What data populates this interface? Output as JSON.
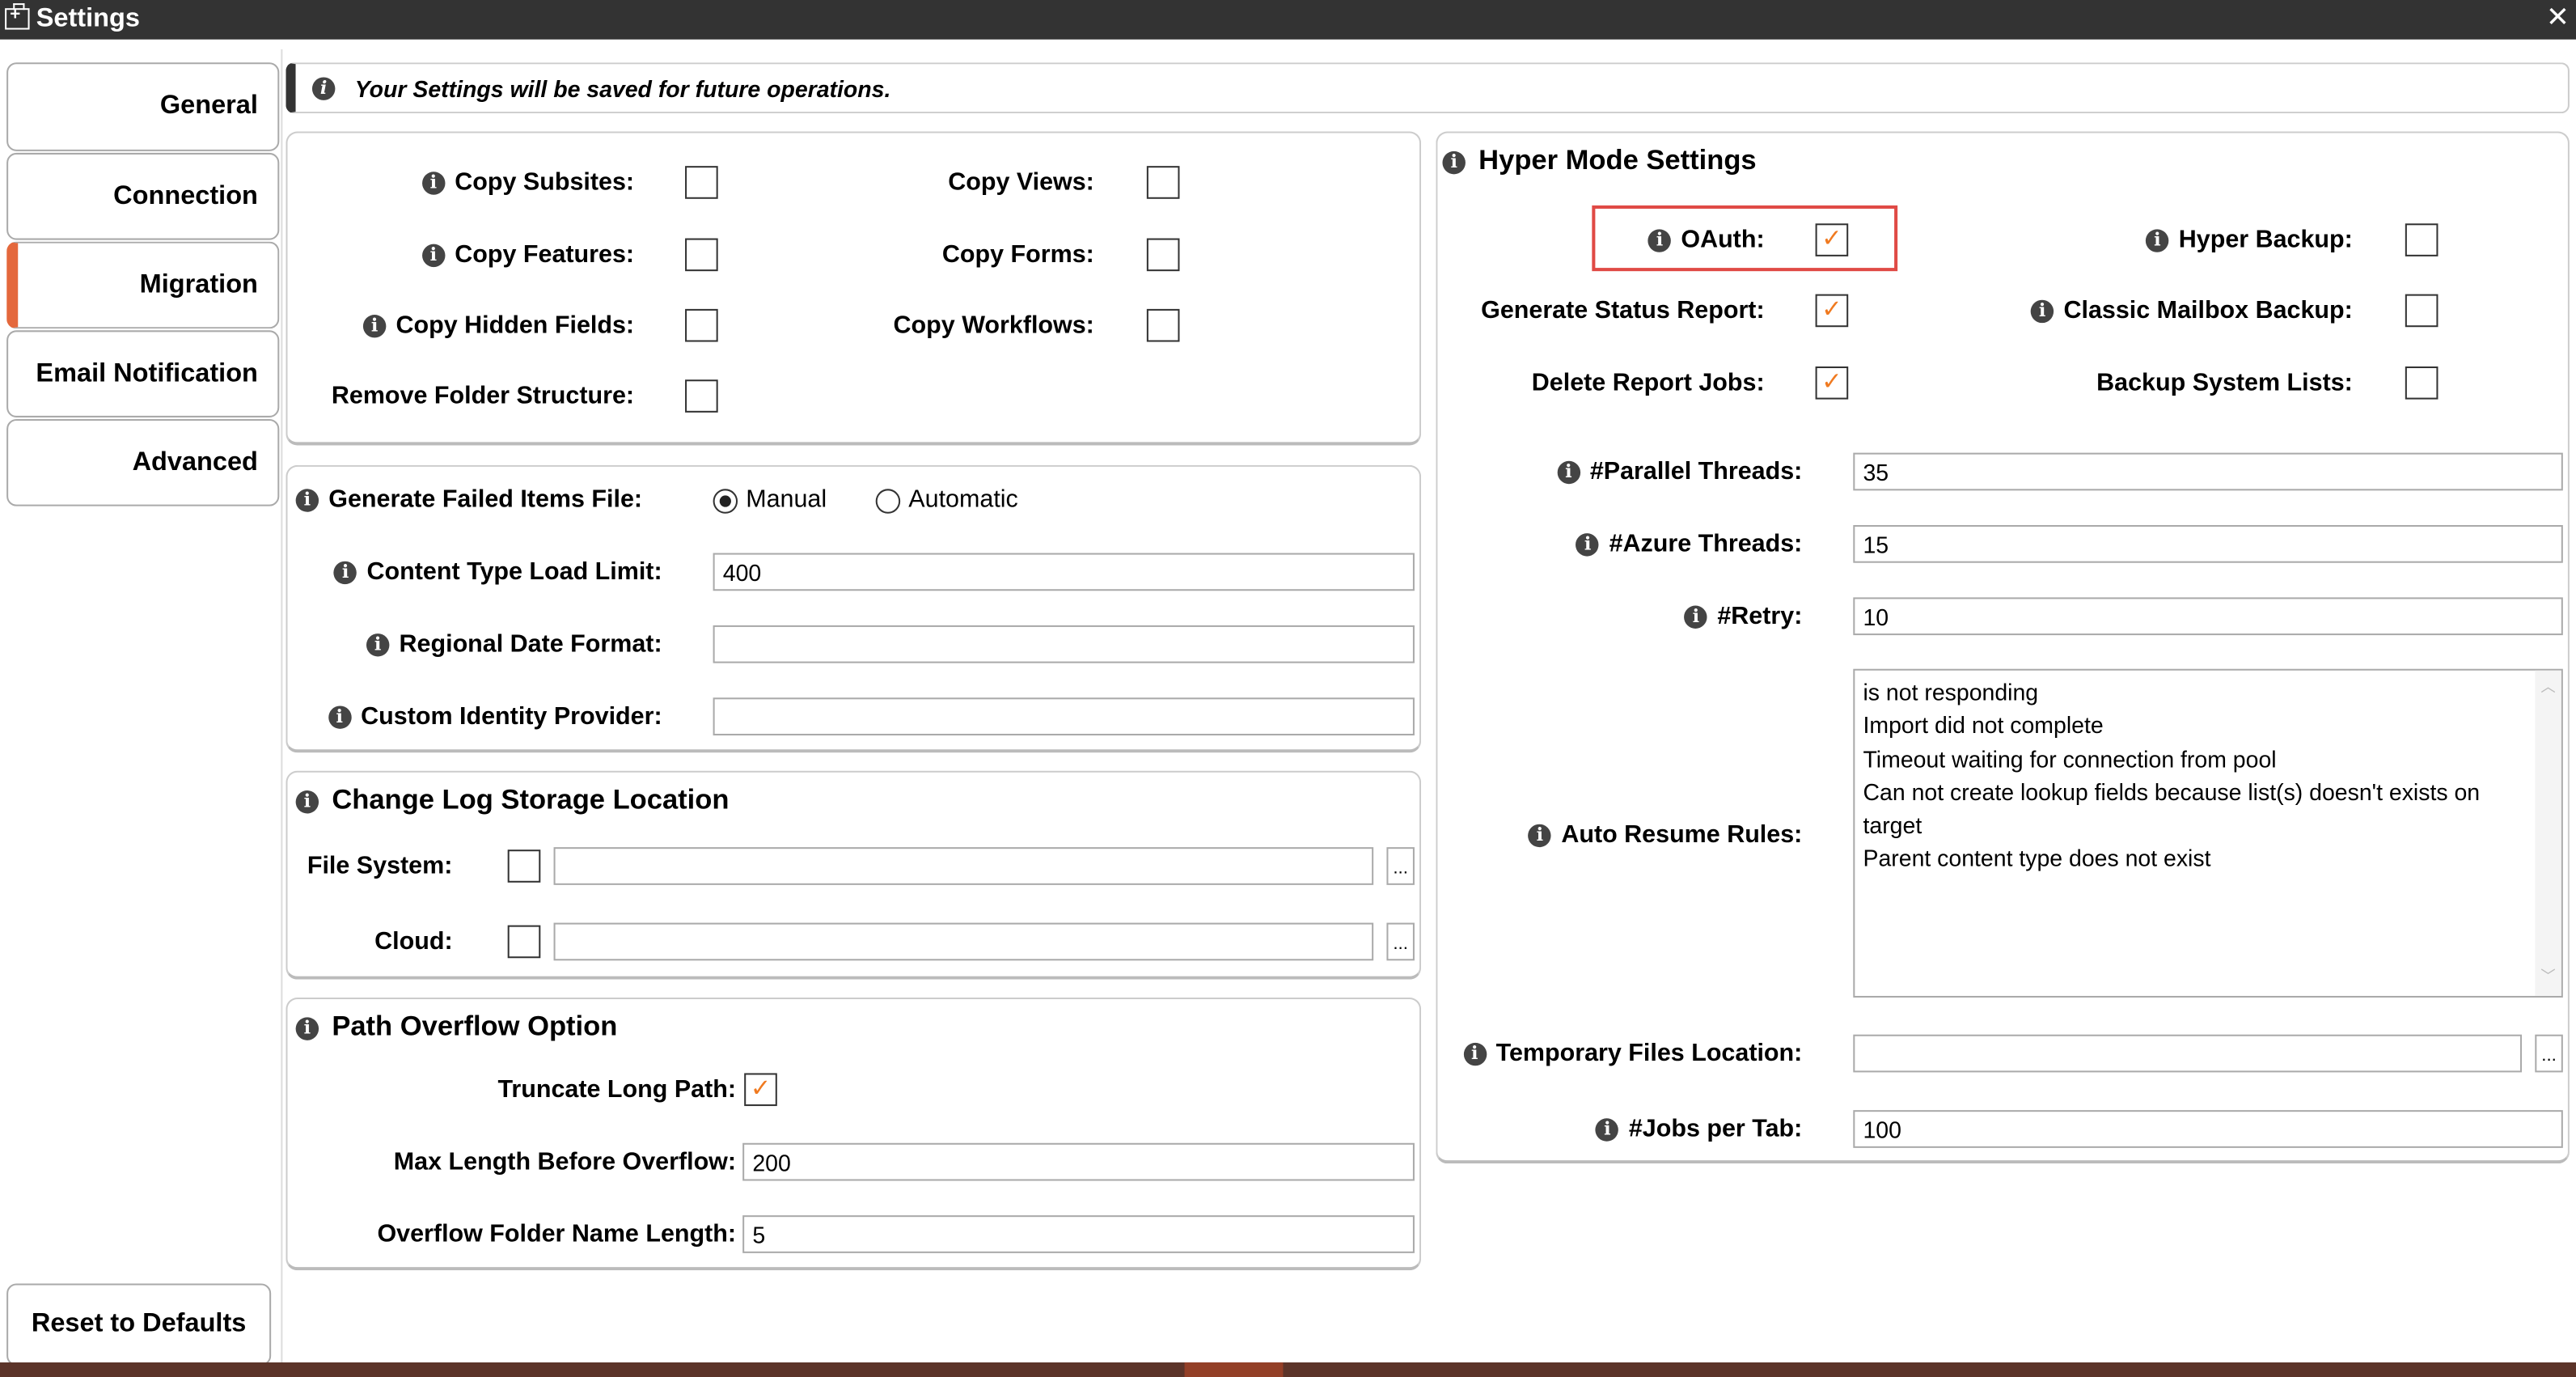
{
  "window": {
    "title": "Settings",
    "close_icon": "close-icon"
  },
  "sidebar": {
    "tabs": [
      {
        "label": "General"
      },
      {
        "label": "Connection"
      },
      {
        "label": "Migration",
        "active": true
      },
      {
        "label": "Email Notification"
      },
      {
        "label": "Advanced"
      }
    ],
    "reset_label": "Reset to Defaults"
  },
  "banner": {
    "text": "Your Settings will be saved for future operations."
  },
  "copy_options": {
    "copy_subsites": {
      "label": "Copy Subsites:",
      "checked": false
    },
    "copy_features": {
      "label": "Copy Features:",
      "checked": false
    },
    "copy_hidden_fields": {
      "label": "Copy Hidden Fields:",
      "checked": false
    },
    "remove_folder_structure": {
      "label": "Remove Folder Structure:",
      "checked": false
    },
    "copy_views": {
      "label": "Copy Views:",
      "checked": false
    },
    "copy_forms": {
      "label": "Copy Forms:",
      "checked": false
    },
    "copy_workflows": {
      "label": "Copy Workflows:",
      "checked": false
    }
  },
  "failed_items": {
    "label": "Generate Failed Items File:",
    "options": [
      "Manual",
      "Automatic"
    ],
    "selected": "Manual"
  },
  "content_type_load_limit": {
    "label": "Content Type Load Limit:",
    "value": "400"
  },
  "regional_date_format": {
    "label": "Regional Date Format:",
    "value": ""
  },
  "custom_identity_provider": {
    "label": "Custom Identity Provider:",
    "value": ""
  },
  "change_log": {
    "title": "Change Log Storage Location",
    "file_system_label": "File System:",
    "cloud_label": "Cloud:",
    "browse": "..."
  },
  "path_overflow": {
    "title": "Path Overflow Option",
    "truncate_label": "Truncate Long Path:",
    "truncate_checked": true,
    "max_length_label": "Max Length Before Overflow:",
    "max_length": "200",
    "folder_name_label": "Overflow Folder Name Length:",
    "folder_name_length": "5"
  },
  "hyper": {
    "title": "Hyper Mode Settings",
    "oauth": {
      "label": "OAuth:",
      "checked": true
    },
    "generate_status_report": {
      "label": "Generate Status Report:",
      "checked": true
    },
    "delete_report_jobs": {
      "label": "Delete Report Jobs:",
      "checked": true
    },
    "hyper_backup": {
      "label": "Hyper Backup:",
      "checked": false
    },
    "classic_mailbox_backup": {
      "label": "Classic Mailbox Backup:",
      "checked": false
    },
    "backup_system_lists": {
      "label": "Backup System Lists:",
      "checked": false
    },
    "parallel_threads": {
      "label": "#Parallel Threads:",
      "value": "35"
    },
    "azure_threads": {
      "label": "#Azure Threads:",
      "value": "15"
    },
    "retry": {
      "label": "#Retry:",
      "value": "10"
    },
    "auto_resume": {
      "label": "Auto Resume Rules:",
      "rules": [
        "is not responding",
        "Import did not complete",
        "Timeout waiting for connection from pool",
        "Can not create lookup fields because list(s) doesn't exists on target",
        "Parent content type does not exist"
      ]
    },
    "temp_files": {
      "label": "Temporary Files Location:",
      "value": "",
      "browse": "..."
    },
    "jobs_per_tab": {
      "label": "#Jobs per Tab:",
      "value": "100"
    }
  },
  "colors": {
    "accent": "#e4683c",
    "check": "#f07a20",
    "highlight": "#e04a45",
    "titlebar": "#333333"
  }
}
